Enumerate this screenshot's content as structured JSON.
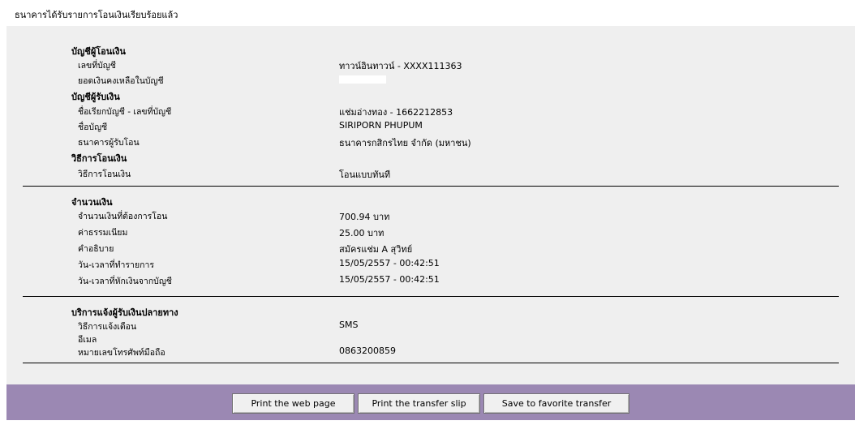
{
  "header": {
    "message": "ธนาคารได้รับรายการโอนเงินเรียบร้อยแล้ว"
  },
  "source_account": {
    "title": "บัญชีผู้โอนเงิน",
    "account_no_label": "เลขที่บัญชี",
    "account_no": "ทาวน์อินทาวน์ - XXXX111363",
    "balance_label": "ยอดเงินคงเหลือในบัญชี"
  },
  "recipient_account": {
    "title": "บัญชีผู้รับเงิน",
    "nickname_label": "ชื่อเรียกบัญชี - เลขที่บัญชี",
    "nickname": "แช่มอ่างทอง - 1662212853",
    "account_name_label": "ชื่อบัญชี",
    "account_name": "SIRIPORN PHUPUM",
    "bank_label": "ธนาคารผู้รับโอน",
    "bank": "ธนาคารกสิกรไทย จำกัด (มหาชน)"
  },
  "transfer_method": {
    "title": "วิธีการโอนเงิน",
    "method_label": "วิธีการโอนเงิน",
    "method": "โอนแบบทันที"
  },
  "amount": {
    "title": "จำนวนเงิน",
    "amount_label": "จำนวนเงินที่ต้องการโอน",
    "amount": "700.94 บาท",
    "fee_label": "ค่าธรรมเนียม",
    "fee": "25.00  บาท",
    "desc_label": "คำอธิบาย",
    "desc": "สมัครแช่ม A สุวิทย์",
    "trans_time_label": "วัน-เวลาที่ทำรายการ",
    "trans_time": "15/05/2557 - 00:42:51",
    "debit_time_label": "วัน-เวลาที่หักเงินจากบัญชี",
    "debit_time": "15/05/2557 - 00:42:51"
  },
  "notify": {
    "title": "บริการแจ้งผู้รับเงินปลายทาง",
    "method_label": "วิธีการแจ้งเตือน",
    "method": "SMS",
    "email_label": "อีเมล",
    "phone_label": "หมายเลขโทรศัพท์มือถือ",
    "phone": "0863200859"
  },
  "buttons": {
    "print_page": "Print the web page",
    "print_slip": "Print the transfer slip",
    "save_favorite": "Save to favorite transfer"
  },
  "colors": {
    "panel_bg": "#efefef",
    "button_bar": "#9b88b3"
  }
}
